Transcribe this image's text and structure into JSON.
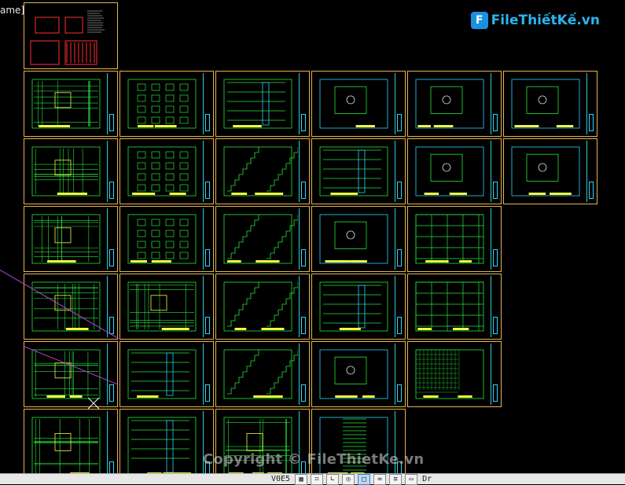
{
  "viewport": {
    "label": "ame]"
  },
  "logo": {
    "text": "FileThiếtKế.vn",
    "badge": "F"
  },
  "watermark": {
    "text": "Copyright © FileThietKe.vn"
  },
  "statusbar": {
    "coords": "V0E5",
    "buttons": [
      "grid-icon",
      "snap-icon",
      "ortho-icon",
      "polar-icon",
      "osnap-icon",
      "otrack-icon",
      "lineweight-icon",
      "model-icon"
    ],
    "tail": "Dr"
  },
  "colors": {
    "sheet_border": "#e6b450",
    "cad_green": "#27e43a",
    "cad_cyan": "#2bd4ff",
    "cad_yellow": "#f5f542",
    "cad_red": "#ff3030",
    "selection": "#c043e0"
  },
  "sheets": [
    {
      "name": "sheet-cover",
      "kind": "cover"
    },
    {
      "name": "sheet-r1c1",
      "kind": "plan"
    },
    {
      "name": "sheet-r1c2",
      "kind": "elevation"
    },
    {
      "name": "sheet-r1c3",
      "kind": "section"
    },
    {
      "name": "sheet-r1c4",
      "kind": "detail"
    },
    {
      "name": "sheet-r1c5",
      "kind": "detail"
    },
    {
      "name": "sheet-r1c6",
      "kind": "detail"
    },
    {
      "name": "sheet-r2c1",
      "kind": "plan"
    },
    {
      "name": "sheet-r2c2",
      "kind": "elevation"
    },
    {
      "name": "sheet-r2c3",
      "kind": "stair"
    },
    {
      "name": "sheet-r2c4",
      "kind": "section"
    },
    {
      "name": "sheet-r2c5",
      "kind": "detail"
    },
    {
      "name": "sheet-r2c6",
      "kind": "detail"
    },
    {
      "name": "sheet-r3c1",
      "kind": "plan"
    },
    {
      "name": "sheet-r3c2",
      "kind": "elevation"
    },
    {
      "name": "sheet-r3c3",
      "kind": "stair"
    },
    {
      "name": "sheet-r3c4",
      "kind": "detail"
    },
    {
      "name": "sheet-r3c5",
      "kind": "table"
    },
    {
      "name": "sheet-r4c1",
      "kind": "plan"
    },
    {
      "name": "sheet-r4c2",
      "kind": "plan"
    },
    {
      "name": "sheet-r4c3",
      "kind": "stair"
    },
    {
      "name": "sheet-r4c4",
      "kind": "section"
    },
    {
      "name": "sheet-r4c5",
      "kind": "table"
    },
    {
      "name": "sheet-r5c1",
      "kind": "plan"
    },
    {
      "name": "sheet-r5c2",
      "kind": "section"
    },
    {
      "name": "sheet-r5c3",
      "kind": "stair"
    },
    {
      "name": "sheet-r5c4",
      "kind": "detail"
    },
    {
      "name": "sheet-r5c5",
      "kind": "grid"
    },
    {
      "name": "sheet-r6c1",
      "kind": "plan"
    },
    {
      "name": "sheet-r6c2",
      "kind": "section"
    },
    {
      "name": "sheet-r6c3",
      "kind": "plan"
    },
    {
      "name": "sheet-r6c4",
      "kind": "notes"
    }
  ]
}
